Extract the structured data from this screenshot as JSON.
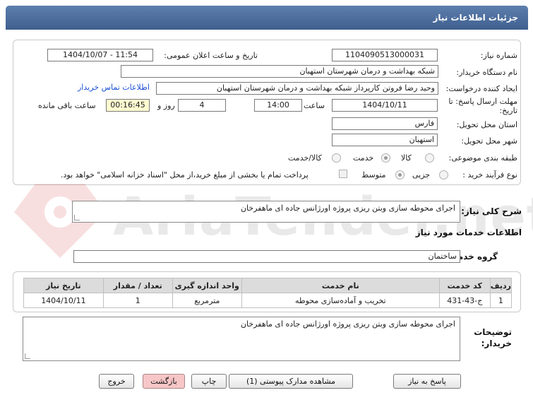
{
  "header": {
    "title": "جزئیات اطلاعات نیاز"
  },
  "form": {
    "need_number_label": "شماره نیاز:",
    "need_number": "1104090513000031",
    "announce_label": "تاریخ و ساعت اعلان عمومی:",
    "announce_value": "1404/10/07 - 11:54",
    "buyer_org_label": "نام دستگاه خریدار:",
    "buyer_org": "شبکه بهداشت و درمان شهرستان استهبان",
    "creator_label": "ایجاد کننده درخواست:",
    "creator": "وحید رضا فروتن کارپرداز شبکه بهداشت و درمان شهرستان استهبان",
    "contact_link": "اطلاعات تماس خریدار",
    "deadline_label": "مهلت ارسال پاسخ: تا تاریخ:",
    "deadline_date": "1404/10/11",
    "time_label": "ساعت",
    "deadline_time": "14:00",
    "days_value": "4",
    "days_label": "روز و",
    "remaining_time": "00:16:45",
    "remaining_label": "ساعت باقی مانده",
    "province_label": "استان محل تحویل:",
    "province": "فارس",
    "city_label": "شهر محل تحویل:",
    "city": "استهبان",
    "category_label": "طبقه بندی موضوعی:",
    "category_options": [
      "کالا",
      "خدمت",
      "کالا/خدمت"
    ],
    "category_selected": "خدمت",
    "process_label": "نوع فرآیند خرید :",
    "process_options": [
      "جزیی",
      "متوسط"
    ],
    "process_selected": "متوسط",
    "payment_note": "پرداخت تمام یا بخشی از مبلغ خرید،از محل \"اسناد خزانه اسلامی\" خواهد بود."
  },
  "description": {
    "label": "شرح کلی نیاز:",
    "text": "اجرای محوطه سازی وبتن ریزی پروژه اورژانس جاده ای ماهفرخان"
  },
  "services": {
    "section_title": "اطلاعات خدمات مورد نیاز",
    "group_label": "گروه خدمت:",
    "group_value": "ساختمان",
    "columns": [
      "ردیف",
      "کد خدمت",
      "نام خدمت",
      "واحد اندازه گیری",
      "تعداد / مقدار",
      "تاریخ نیاز"
    ],
    "rows": [
      [
        "1",
        "ج-43-431",
        "تخریب و آماده‌سازی محوطه",
        "مترمربع",
        "1",
        "1404/10/11"
      ]
    ]
  },
  "buyer_notes": {
    "label": "توضیحات خریدار:",
    "text": "اجرای محوطه سازی وبتن ریزی پروژه اورژانس جاده ای ماهفرخان"
  },
  "buttons": {
    "reply": "پاسخ به نیاز",
    "attachments": "مشاهده مدارک پیوستی (1)",
    "print": "چاپ",
    "back": "بازگشت",
    "exit": "خروج"
  },
  "watermark": {
    "text": "AriaTender.net"
  }
}
